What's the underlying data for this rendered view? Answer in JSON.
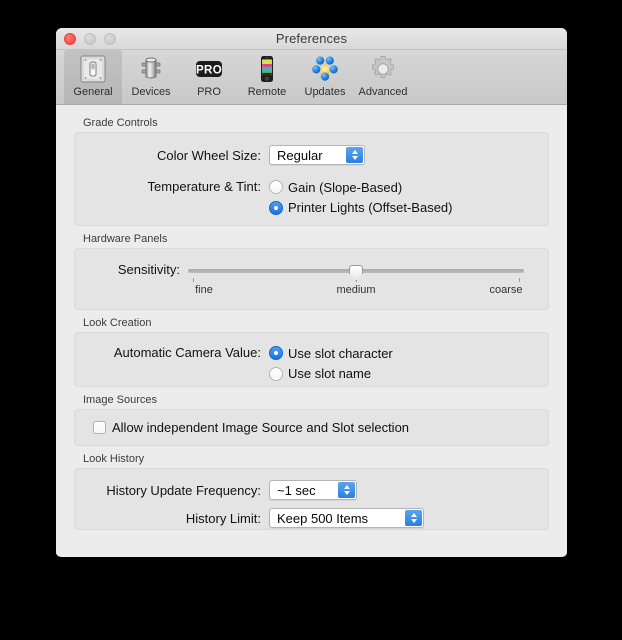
{
  "window": {
    "title": "Preferences",
    "traffic_lights": [
      {
        "name": "close",
        "color": "#fa5e57"
      },
      {
        "name": "minimize",
        "color": "#cdcdcd"
      },
      {
        "name": "maximize",
        "color": "#cdcdcd"
      }
    ]
  },
  "toolbar": {
    "items": [
      {
        "label": "General",
        "icon": "general-switch-icon",
        "selected": true
      },
      {
        "label": "Devices",
        "icon": "devices-panel-icon",
        "selected": false
      },
      {
        "label": "PRO",
        "icon": "pro-badge-icon",
        "selected": false
      },
      {
        "label": "Remote",
        "icon": "remote-phone-icon",
        "selected": false
      },
      {
        "label": "Updates",
        "icon": "updates-spheres-icon",
        "selected": false
      },
      {
        "label": "Advanced",
        "icon": "advanced-gear-icon",
        "selected": false
      }
    ]
  },
  "sections": {
    "grade_controls": {
      "title": "Grade Controls",
      "color_wheel_size": {
        "label": "Color Wheel Size:",
        "value": "Regular"
      },
      "temperature_tint": {
        "label": "Temperature & Tint:",
        "options": [
          {
            "label": "Gain (Slope-Based)",
            "selected": false
          },
          {
            "label": "Printer Lights (Offset-Based)",
            "selected": true
          }
        ]
      }
    },
    "hardware_panels": {
      "title": "Hardware Panels",
      "sensitivity": {
        "label": "Sensitivity:",
        "value": "medium",
        "percent": 50,
        "ticks": [
          "fine",
          "medium",
          "coarse"
        ]
      }
    },
    "look_creation": {
      "title": "Look Creation",
      "automatic_camera_value": {
        "label": "Automatic Camera Value:",
        "options": [
          {
            "label": "Use slot character",
            "selected": true
          },
          {
            "label": "Use slot name",
            "selected": false
          }
        ]
      }
    },
    "image_sources": {
      "title": "Image Sources",
      "allow_independent": {
        "label": "Allow independent Image Source and Slot selection",
        "checked": false
      }
    },
    "look_history": {
      "title": "Look History",
      "history_update_frequency": {
        "label": "History Update Frequency:",
        "value": "~1 sec"
      },
      "history_limit": {
        "label": "History Limit:",
        "value": "Keep 500 Items"
      }
    }
  },
  "colors": {
    "accent_blue": "#2a7ee0",
    "window_bg": "#ececec",
    "group_bg": "#e4e4e4",
    "toolbar_bg": "#cfcfcf"
  }
}
